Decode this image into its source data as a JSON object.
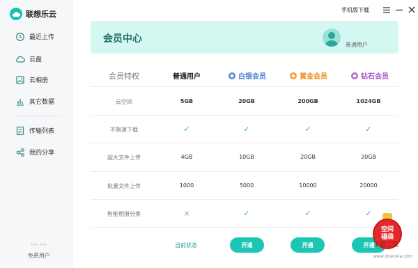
{
  "app": {
    "name": "联想乐云"
  },
  "sidebar": {
    "items": [
      {
        "label": "最近上传",
        "icon": "clock-icon"
      },
      {
        "label": "云盘",
        "icon": "cloud-icon"
      },
      {
        "label": "云相册",
        "icon": "image-icon"
      },
      {
        "label": "其它数据",
        "icon": "chart-icon"
      },
      {
        "label": "传输列表",
        "icon": "list-icon"
      },
      {
        "label": "我的分享",
        "icon": "share-icon"
      }
    ],
    "user": {
      "name": "*** ***",
      "type": "免费用户"
    }
  },
  "topbar": {
    "download_link": "手机版下载"
  },
  "header": {
    "title": "会员中心",
    "user_name": "",
    "user_type": "普通用户"
  },
  "table": {
    "feature_header": "会员特权",
    "columns": [
      "普通用户",
      "白银会员",
      "黄金会员",
      "钻石会员"
    ],
    "rows": [
      {
        "feature": "云空间",
        "values": [
          "5GB",
          "20GB",
          "200GB",
          "1024GB"
        ]
      },
      {
        "feature": "不限速下载",
        "values": [
          "✓",
          "✓",
          "✓",
          "✓"
        ]
      },
      {
        "feature": "超大文件上传",
        "values": [
          "4GB",
          "10GB",
          "20GB",
          "20GB"
        ]
      },
      {
        "feature": "批量文件上传",
        "values": [
          "1000",
          "5000",
          "10000",
          "20000"
        ]
      },
      {
        "feature": "智能相册分类",
        "values": [
          "×",
          "✓",
          "✓",
          "✓"
        ]
      }
    ],
    "current_state": "当前状态",
    "open_label": "开通"
  },
  "promo": {
    "line1": "空间",
    "line2": "福袋"
  },
  "watermark": {
    "logo": "下载之家",
    "url": "www.downxia.com"
  },
  "colors": {
    "accent": "#1cc6b3",
    "silver": "#4a7bd6",
    "gold": "#ee8a1a",
    "diamond": "#a855c7",
    "header_bg": "#d4f7f2"
  }
}
